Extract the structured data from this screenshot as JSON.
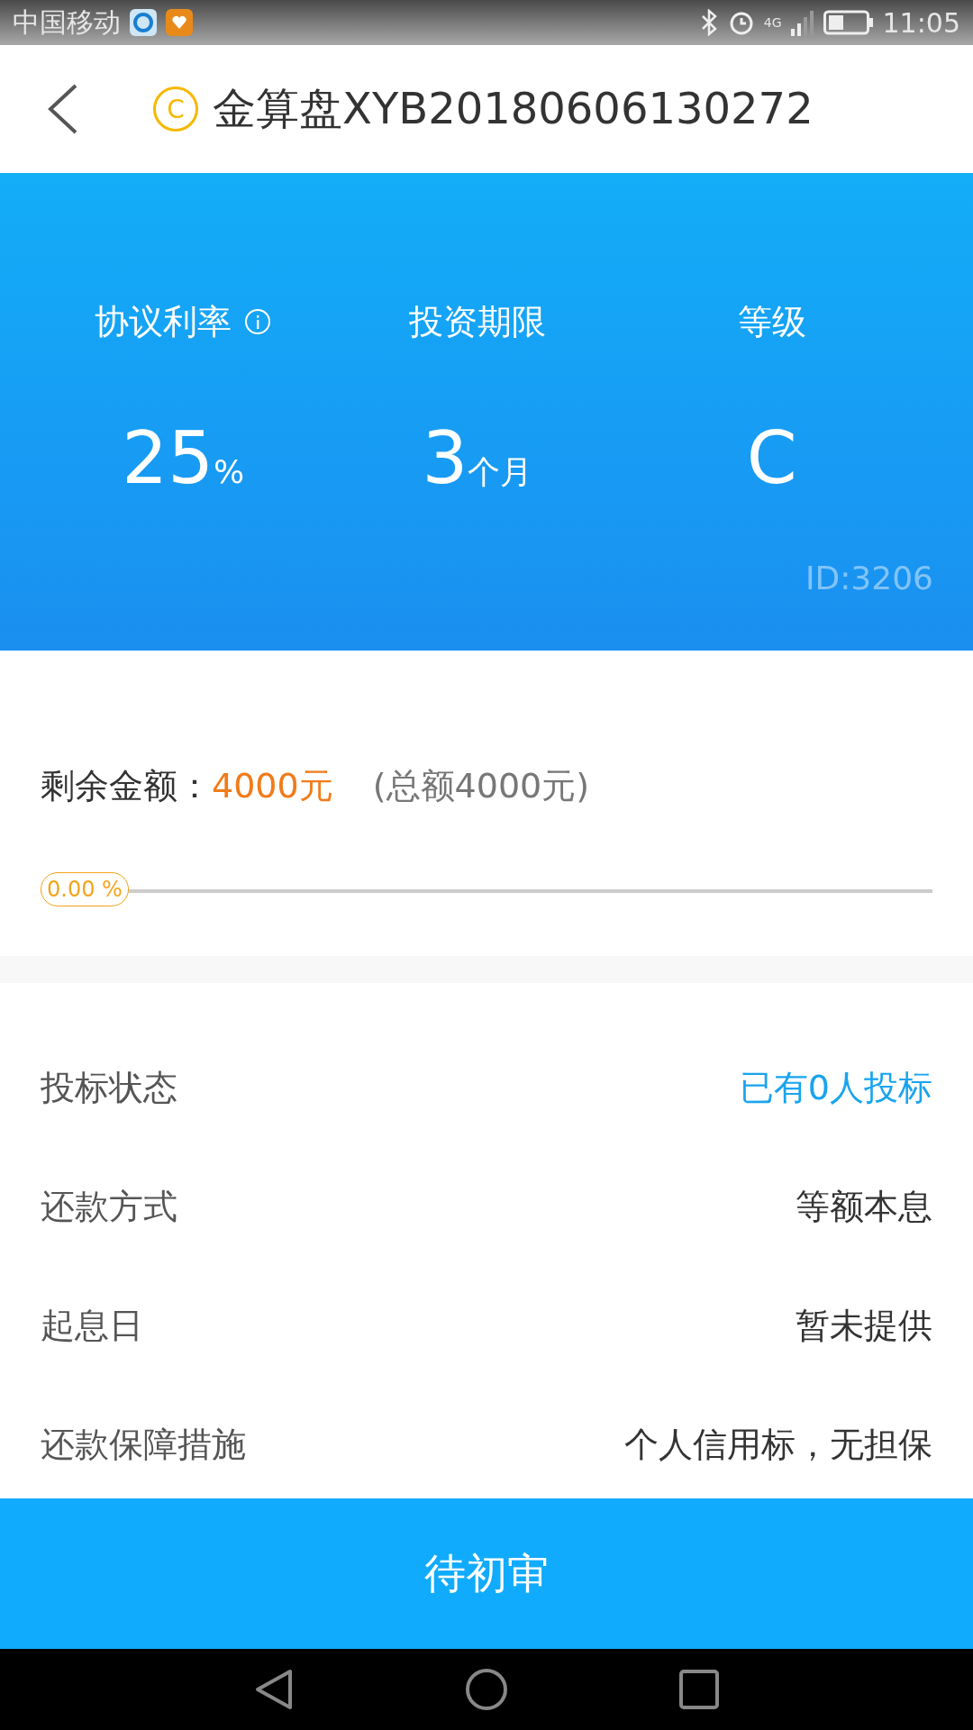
{
  "status_bar": {
    "carrier": "中国移动",
    "network": "4G",
    "time": "11:05"
  },
  "header": {
    "badge": "C",
    "title": "金算盘XYB20180606130272"
  },
  "summary": {
    "stats": [
      {
        "label": "协议利率",
        "info": true,
        "value": "25",
        "unit": "%"
      },
      {
        "label": "投资期限",
        "info": false,
        "value": "3",
        "unit": "个月"
      },
      {
        "label": "等级",
        "info": false,
        "value": "C"
      }
    ],
    "id": "ID:3206"
  },
  "amount": {
    "label": "剩余金额：",
    "remaining": "4000元",
    "total": "(总额4000元)"
  },
  "progress": {
    "level": 0,
    "reading": "0.00 %"
  },
  "details": [
    {
      "label": "投标状态",
      "value": "已有0人投标",
      "highlight": true
    },
    {
      "label": "还款方式",
      "value": "等额本息",
      "highlight": false
    },
    {
      "label": "起息日",
      "value": "暂未提供",
      "highlight": false
    },
    {
      "label": "还款保障措施",
      "value": "个人信用标，无担保",
      "highlight": false
    }
  ],
  "action_button": "待初审"
}
